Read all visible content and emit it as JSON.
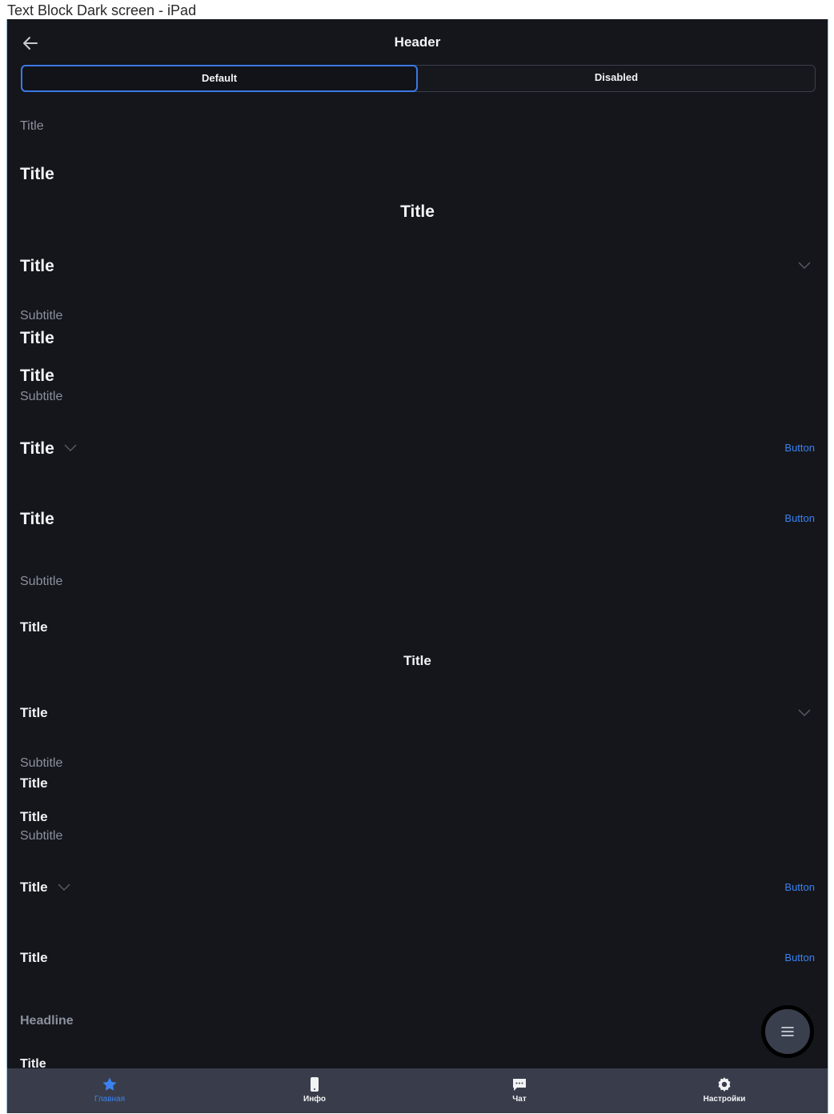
{
  "caption": "Text Block Dark screen - iPad",
  "header": {
    "title": "Header"
  },
  "segments": {
    "default": "Default",
    "disabled": "Disabled"
  },
  "blocks": {
    "b1_title_small": "Title",
    "b2_title": "Title",
    "b3_title_center": "Title",
    "b4_title": "Title",
    "b5_subtitle": "Subtitle",
    "b5_title": "Title",
    "b6_title": "Title",
    "b6_subtitle": "Subtitle",
    "b7_title": "Title",
    "b7_button": "Button",
    "b8_title": "Title",
    "b8_button": "Button",
    "b9_subtitle": "Subtitle",
    "b10_title": "Title",
    "b11_title_center": "Title",
    "b12_title": "Title",
    "b13_subtitle": "Subtitle",
    "b13_title": "Title",
    "b14_title": "Title",
    "b14_subtitle": "Subtitle",
    "b15_title": "Title",
    "b15_button": "Button",
    "b16_title": "Title",
    "b16_button": "Button",
    "b17_headline": "Headline",
    "b18_title": "Title"
  },
  "tabs": [
    {
      "label": "Главная",
      "icon": "star-icon",
      "active": true
    },
    {
      "label": "Инфо",
      "icon": "phone-icon",
      "active": false
    },
    {
      "label": "Чат",
      "icon": "chat-icon",
      "active": false
    },
    {
      "label": "Настройки",
      "icon": "gear-icon",
      "active": false
    }
  ],
  "colors": {
    "accent": "#3b82f0",
    "background": "#14161c",
    "tabbar": "#393d4b"
  }
}
